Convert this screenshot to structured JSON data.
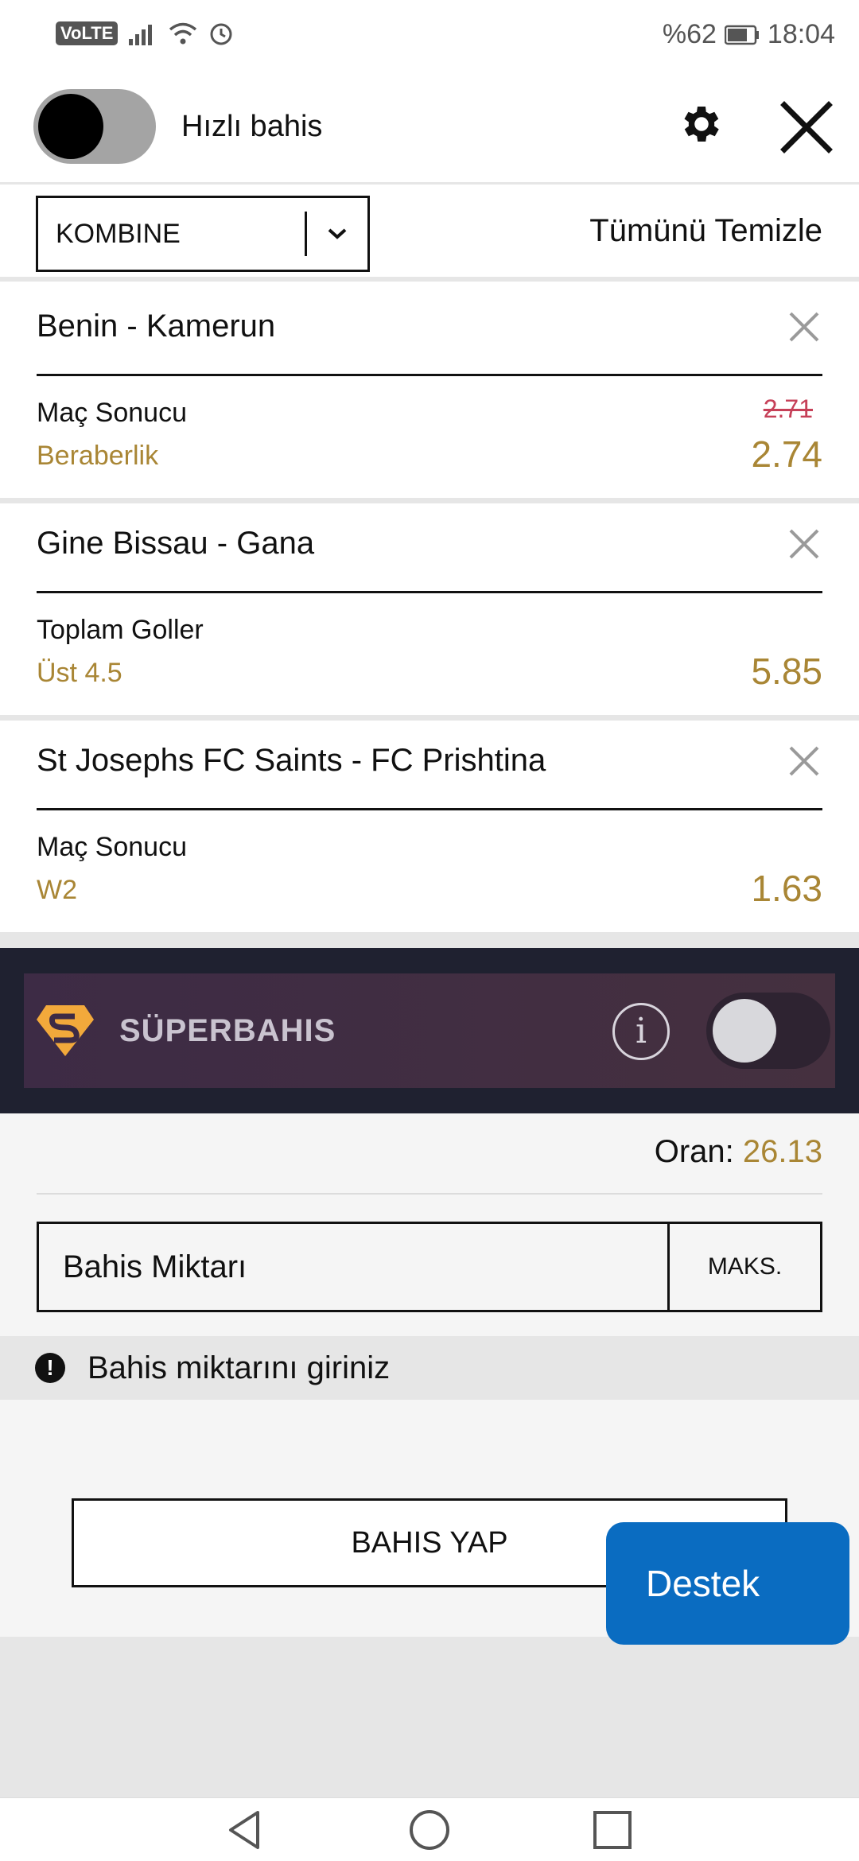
{
  "status": {
    "volte": "VoLTE",
    "battery": "%62",
    "time": "18:04",
    "icons": [
      "signal-icon",
      "wifi-icon",
      "alarm-icon",
      "battery-icon"
    ]
  },
  "header": {
    "fast_bet_label": "Hızlı bahis",
    "fast_bet_on": false
  },
  "selector": {
    "bet_type": "KOMBINE",
    "clear_all": "Tümünü Temizle"
  },
  "bets": [
    {
      "match": "Benin - Kamerun",
      "market": "Maç Sonucu",
      "selection": "Beraberlik",
      "old_odds": "2.71",
      "odds": "2.74"
    },
    {
      "match": "Gine Bissau - Gana",
      "market": "Toplam Goller",
      "selection": "Üst 4.5",
      "odds": "5.85"
    },
    {
      "match": "St Josephs FC Saints - FC Prishtina",
      "market": "Maç Sonucu",
      "selection": "W2",
      "odds": "1.63"
    }
  ],
  "superbahis": {
    "title": "SÜPERBAHIS",
    "info": "i",
    "enabled": false
  },
  "summary": {
    "odds_label": "Oran:",
    "odds_value": "26.13",
    "stake_placeholder": "Bahis Miktarı",
    "max_label": "MAKS.",
    "warning": "Bahis miktarını giriniz",
    "place_bet": "BAHIS YAP"
  },
  "support": {
    "label": "Destek"
  },
  "colors": {
    "accent_gold": "#a98635",
    "old_odds_red": "#c64058",
    "support_blue": "#0a6cc1",
    "superbahis_bg": "#3d2b45"
  }
}
